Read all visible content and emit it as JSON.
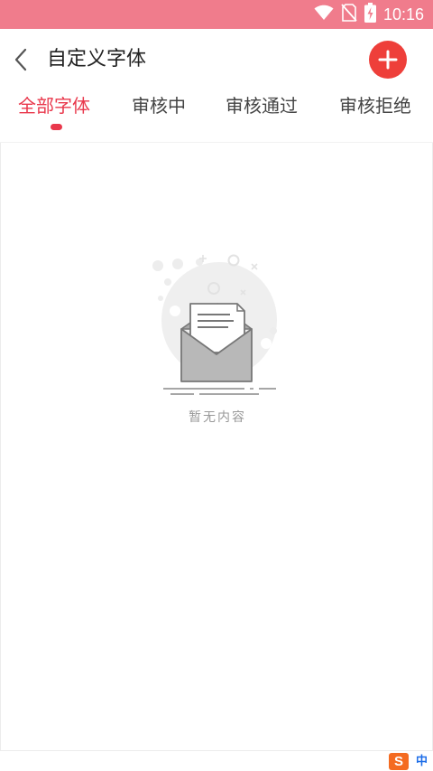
{
  "status_bar": {
    "time": "10:16",
    "icons": [
      "wifi-icon",
      "no-sim-icon",
      "battery-charging-icon"
    ],
    "background": "#f07c8c"
  },
  "header": {
    "title": "自定义字体",
    "back_icon": "chevron-left-icon",
    "add_icon": "plus-icon",
    "add_color": "#ee3f3a"
  },
  "tabs": [
    {
      "label": "全部字体",
      "active": true
    },
    {
      "label": "审核中",
      "active": false
    },
    {
      "label": "审核通过",
      "active": false
    },
    {
      "label": "审核拒绝",
      "active": false
    }
  ],
  "accent": "#e9384c",
  "empty_state": {
    "icon": "open-envelope-icon",
    "text": "暂无内容"
  },
  "ime": {
    "logo": "S",
    "lang": "中"
  }
}
